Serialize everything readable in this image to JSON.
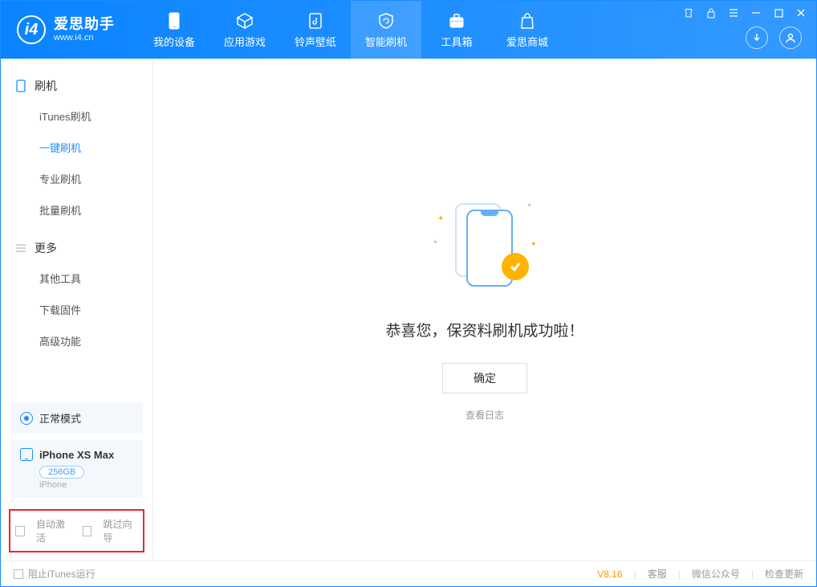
{
  "app": {
    "name": "爱思助手",
    "url": "www.i4.cn"
  },
  "nav": {
    "device": "我的设备",
    "appgame": "应用游戏",
    "ringtone": "铃声壁纸",
    "flash": "智能刷机",
    "toolbox": "工具箱",
    "store": "爱思商城"
  },
  "sidebar": {
    "section_flash": "刷机",
    "items_flash": {
      "itunes": "iTunes刷机",
      "onekey": "一键刷机",
      "pro": "专业刷机",
      "batch": "批量刷机"
    },
    "section_more": "更多",
    "items_more": {
      "other": "其他工具",
      "firmware": "下载固件",
      "advanced": "高级功能"
    },
    "mode": "正常模式",
    "device": {
      "name": "iPhone XS Max",
      "storage": "256GB",
      "type": "iPhone"
    },
    "cb_auto": "自动激活",
    "cb_skip": "跳过向导"
  },
  "main": {
    "success": "恭喜您，保资料刷机成功啦！",
    "ok": "确定",
    "log": "查看日志"
  },
  "footer": {
    "block_itunes": "阻止iTunes运行",
    "version": "V8.16",
    "kefu": "客服",
    "wechat": "微信公众号",
    "update": "检查更新"
  }
}
